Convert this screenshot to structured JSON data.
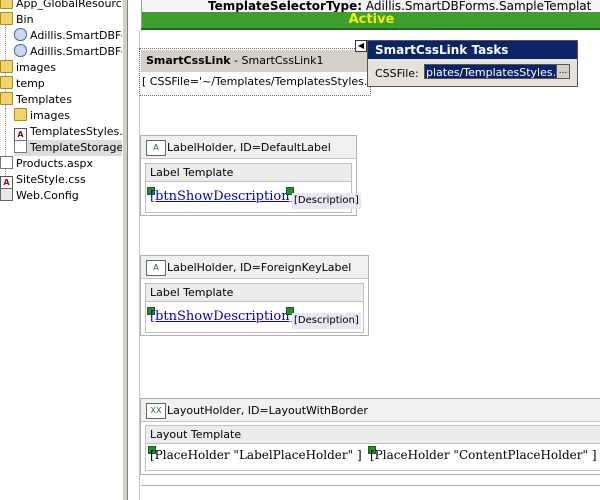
{
  "tree": {
    "items": [
      {
        "label": "App_GlobalResources",
        "icon": "folder-icon"
      },
      {
        "label": "Bin",
        "icon": "folder-icon"
      },
      {
        "label": "Adillis.SmartDBForm",
        "icon": "assembly-icon"
      },
      {
        "label": "Adillis.SmartDBForm",
        "icon": "assembly-icon"
      },
      {
        "label": "images",
        "icon": "folder-icon"
      },
      {
        "label": "temp",
        "icon": "folder-icon"
      },
      {
        "label": "Templates",
        "icon": "folder-icon"
      },
      {
        "label": "images",
        "icon": "folder-icon"
      },
      {
        "label": "TemplatesStyles.cs",
        "icon": "css-file-icon"
      },
      {
        "label": "TemplateStorage.a",
        "icon": "aspx-file-icon"
      },
      {
        "label": "Products.aspx",
        "icon": "aspx-file-icon"
      },
      {
        "label": "SiteStyle.css",
        "icon": "css-file-icon"
      },
      {
        "label": "Web.Config",
        "icon": "config-file-icon"
      }
    ]
  },
  "header": {
    "type_label": "TemplateSelectorType:",
    "type_value": "Adillis.SmartDBForms.SampleTemplat",
    "status": "Active"
  },
  "css_link": {
    "name": "SmartCssLink",
    "id_text": " - SmartCssLink1",
    "body": "[ CSSFile='~/Templates/TemplatesStyles.css' ]"
  },
  "tasks": {
    "title": "SmartCssLink Tasks",
    "css_file_label": "CSSFile:",
    "css_file_value": "plates/TemplatesStyles.css",
    "browse_label": "..."
  },
  "label_holders": [
    {
      "header": "LabelHolder, ID=DefaultLabel",
      "template_label": "Label Template",
      "link_text": "[btnShowDescription]",
      "description": "[Description]"
    },
    {
      "header": "LabelHolder, ID=ForeignKeyLabel",
      "template_label": "Label Template",
      "link_text": "[btnShowDescription]",
      "description": "[Description]"
    }
  ],
  "layout_holder": {
    "header": "LayoutHolder, ID=LayoutWithBorder",
    "template_label": "Layout Template",
    "placeholder_1": "[PlaceHolder \"LabelPlaceHolder\" ]",
    "placeholder_2": "[PlaceHolder \"ContentPlaceHolder\" ]"
  }
}
